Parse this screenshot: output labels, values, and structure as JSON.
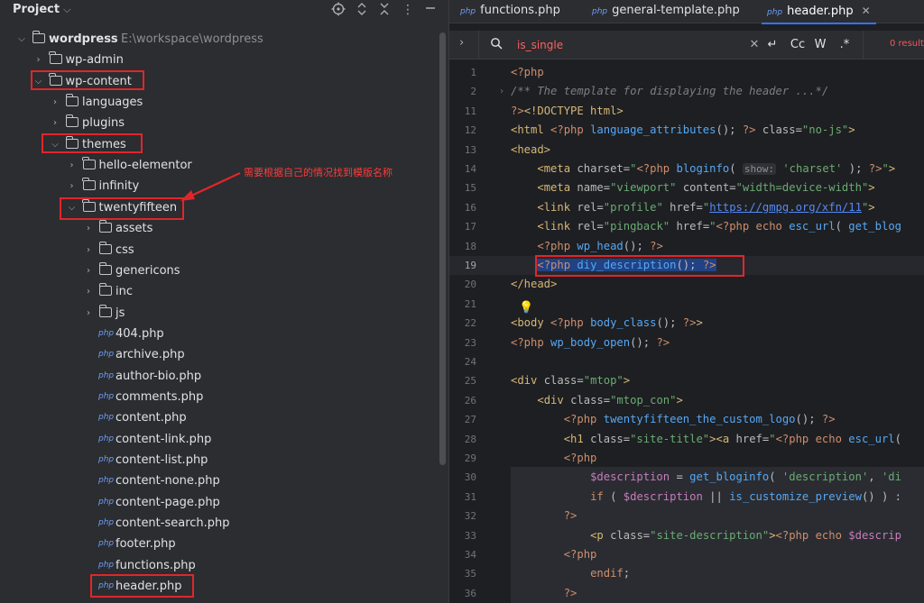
{
  "project": {
    "title": "Project",
    "tree": [
      {
        "name": "wordpress",
        "path": "E:\\workspace\\wordpress",
        "type": "folder",
        "expanded": true,
        "level": 0
      },
      {
        "name": "wp-admin",
        "type": "folder",
        "expanded": false,
        "level": 1
      },
      {
        "name": "wp-content",
        "type": "folder",
        "expanded": true,
        "level": 1
      },
      {
        "name": "languages",
        "type": "folder",
        "expanded": false,
        "level": 2
      },
      {
        "name": "plugins",
        "type": "folder",
        "expanded": false,
        "level": 2
      },
      {
        "name": "themes",
        "type": "folder",
        "expanded": true,
        "level": 2
      },
      {
        "name": "hello-elementor",
        "type": "folder",
        "expanded": false,
        "level": 3
      },
      {
        "name": "infinity",
        "type": "folder",
        "expanded": false,
        "level": 3
      },
      {
        "name": "twentyfifteen",
        "type": "folder",
        "expanded": true,
        "level": 3
      },
      {
        "name": "assets",
        "type": "folder",
        "expanded": false,
        "level": 4
      },
      {
        "name": "css",
        "type": "folder",
        "expanded": false,
        "level": 4
      },
      {
        "name": "genericons",
        "type": "folder",
        "expanded": false,
        "level": 4
      },
      {
        "name": "inc",
        "type": "folder",
        "expanded": false,
        "level": 4
      },
      {
        "name": "js",
        "type": "folder",
        "expanded": false,
        "level": 4
      },
      {
        "name": "404.php",
        "type": "php",
        "level": 4
      },
      {
        "name": "archive.php",
        "type": "php",
        "level": 4
      },
      {
        "name": "author-bio.php",
        "type": "php",
        "level": 4
      },
      {
        "name": "comments.php",
        "type": "php",
        "level": 4
      },
      {
        "name": "content.php",
        "type": "php",
        "level": 4
      },
      {
        "name": "content-link.php",
        "type": "php",
        "level": 4
      },
      {
        "name": "content-list.php",
        "type": "php",
        "level": 4
      },
      {
        "name": "content-none.php",
        "type": "php",
        "level": 4
      },
      {
        "name": "content-page.php",
        "type": "php",
        "level": 4
      },
      {
        "name": "content-search.php",
        "type": "php",
        "level": 4
      },
      {
        "name": "footer.php",
        "type": "php",
        "level": 4
      },
      {
        "name": "functions.php",
        "type": "php",
        "level": 4
      },
      {
        "name": "header.php",
        "type": "php",
        "level": 4
      }
    ],
    "annotation": "需要根据自己的情况找到模版名称"
  },
  "editor": {
    "file_badge": "php",
    "tabs": [
      {
        "label": "functions.php",
        "active": false
      },
      {
        "label": "general-template.php",
        "active": false
      },
      {
        "label": "header.php",
        "active": true
      }
    ],
    "find": {
      "query": "is_single",
      "case_label": "Cc",
      "word_label": "W",
      "regex_label": ".*",
      "results": "0 result"
    },
    "line_numbers": [
      "1",
      "2",
      "11",
      "12",
      "13",
      "14",
      "15",
      "16",
      "17",
      "18",
      "19",
      "20",
      "21",
      "22",
      "23",
      "24",
      "25",
      "26",
      "27",
      "28",
      "29",
      "30",
      "31",
      "32",
      "33",
      "34",
      "35",
      "36"
    ],
    "current_line": "19",
    "hint_show": "show:"
  }
}
